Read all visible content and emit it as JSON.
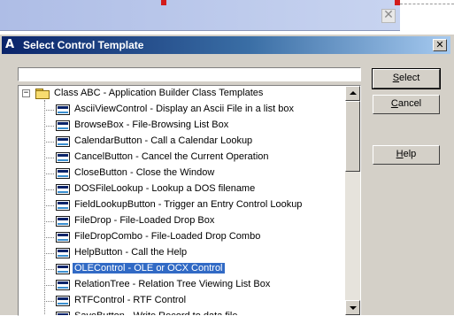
{
  "background_window": {
    "close_glyph": "✕"
  },
  "dialog": {
    "title": "Select Control Template",
    "close_glyph": "✕",
    "title_icon": "A",
    "filter_value": ""
  },
  "tree": {
    "root": {
      "expander": "−",
      "label": "Class ABC - Application Builder Class Templates"
    },
    "items": [
      {
        "label": "AsciiViewControl - Display an Ascii File in a list box"
      },
      {
        "label": "BrowseBox - File-Browsing List Box"
      },
      {
        "label": "CalendarButton - Call a Calendar Lookup"
      },
      {
        "label": "CancelButton - Cancel the Current Operation"
      },
      {
        "label": "CloseButton - Close the Window"
      },
      {
        "label": "DOSFileLookup - Lookup a DOS filename"
      },
      {
        "label": "FieldLookupButton - Trigger an Entry Control Lookup"
      },
      {
        "label": "FileDrop - File-Loaded Drop Box"
      },
      {
        "label": "FileDropCombo - File-Loaded Drop Combo"
      },
      {
        "label": "HelpButton - Call the Help"
      },
      {
        "label": "OLEControl - OLE or OCX Control",
        "selected": true
      },
      {
        "label": "RelationTree - Relation Tree Viewing List Box"
      },
      {
        "label": "RTFControl - RTF Control"
      },
      {
        "label": "SaveButton - Write Record to data file"
      }
    ]
  },
  "buttons": {
    "select_prefix": "",
    "select_underlined": "S",
    "select_rest": "elect",
    "cancel_underlined": "C",
    "cancel_rest": "ancel",
    "help_underlined": "H",
    "help_rest": "elp"
  },
  "colors": {
    "selection": "#316ac5",
    "title_gradient_start": "#0a246a",
    "face": "#d4d0c8"
  }
}
